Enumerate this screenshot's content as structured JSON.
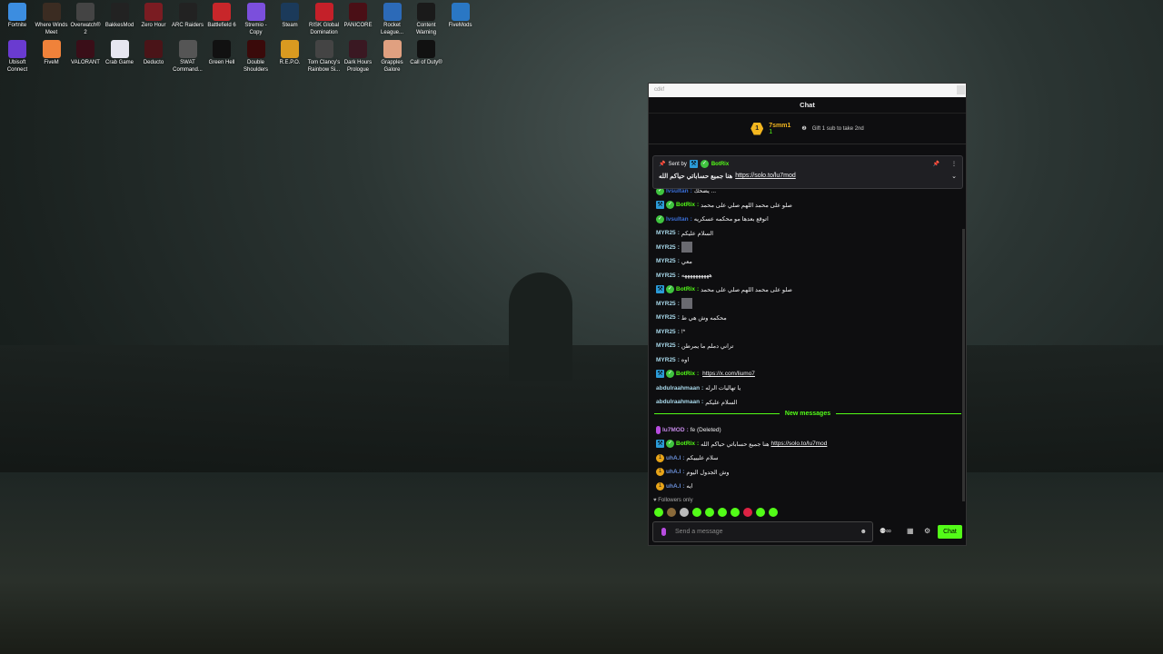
{
  "desktop": {
    "icons": [
      {
        "label": "Fortnite",
        "color": "#3c8de0"
      },
      {
        "label": "Where Winds Meet",
        "color": "#3b2c22"
      },
      {
        "label": "Overwatch® 2",
        "color": "#444"
      },
      {
        "label": "BakkesMod",
        "color": "#222"
      },
      {
        "label": "Zero Hour",
        "color": "#7a1c22"
      },
      {
        "label": "ARC Raiders",
        "color": "#222"
      },
      {
        "label": "Battlefield 6",
        "color": "#c8262a"
      },
      {
        "label": "Stremio - Copy",
        "color": "#7b4fdc"
      },
      {
        "label": "Steam",
        "color": "#1b3a5a"
      },
      {
        "label": "RISK Global Domination",
        "color": "#c42029"
      },
      {
        "label": "PANICORE",
        "color": "#4a0f16"
      },
      {
        "label": "Rocket League...",
        "color": "#2c6ab8"
      },
      {
        "label": "Content Warning",
        "color": "#1a1a1a"
      },
      {
        "label": "FiveMods",
        "color": "#2a77c4"
      },
      {
        "label": "Ubisoft Connect",
        "color": "#6a3bd0"
      },
      {
        "label": "FiveM",
        "color": "#f0823a"
      },
      {
        "label": "VALORANT",
        "color": "#3a0e18"
      },
      {
        "label": "Crab Game",
        "color": "#e6e6f0"
      },
      {
        "label": "Deducto",
        "color": "#4a1418"
      },
      {
        "label": "SWAT Command...",
        "color": "#555"
      },
      {
        "label": "Green Hell",
        "color": "#111"
      },
      {
        "label": "Double Shoulders",
        "color": "#3a0a0a"
      },
      {
        "label": "R.E.P.O.",
        "color": "#d99a20"
      },
      {
        "label": "Tom Clancy's Rainbow Si...",
        "color": "#444"
      },
      {
        "label": "Dark Hours Prologue",
        "color": "#3a1822"
      },
      {
        "label": "Grapples Galore",
        "color": "#e0a080"
      },
      {
        "label": "Call of Duty®",
        "color": "#111"
      }
    ]
  },
  "chat": {
    "address": "cdkf",
    "title": "Chat",
    "leader": {
      "rank": "1",
      "name": "7smm1",
      "count": "1",
      "gift_text": "Gift 1 sub to take 2nd"
    },
    "pinned": {
      "sent_by": "Sent by",
      "user": "BotRix",
      "text": "هنا جميع حساباتي حياكم الله",
      "link": "https://solo.to/lu7mod"
    },
    "messages": [
      {
        "user": "lvsultan",
        "text": "يضحك ...",
        "color": "#3a6fd8",
        "badges": [
          "verified"
        ]
      },
      {
        "user": "BotRix",
        "text": "صلو على محمد اللهم صلي على محمد",
        "color": "#53fc18",
        "badges": [
          "mod",
          "verified"
        ]
      },
      {
        "user": "lvsultan",
        "text": "اتوقع بعدها مو محكمه عسكريه",
        "color": "#3a6fd8",
        "badges": [
          "verified"
        ]
      },
      {
        "user": "MYR25",
        "text": "السلام عليكم",
        "color": "#a8d8ea",
        "badges": []
      },
      {
        "user": "MYR25",
        "text": "[emote]",
        "color": "#a8d8ea",
        "badges": []
      },
      {
        "user": "MYR25",
        "text": "معي",
        "color": "#a8d8ea",
        "badges": []
      },
      {
        "user": "MYR25",
        "text": "ههههههههههه",
        "color": "#a8d8ea",
        "badges": []
      },
      {
        "user": "BotRix",
        "text": "صلو على محمد اللهم صلي على محمد",
        "color": "#53fc18",
        "badges": [
          "mod",
          "verified"
        ]
      },
      {
        "user": "MYR25",
        "text": "[emote]",
        "color": "#a8d8ea",
        "badges": []
      },
      {
        "user": "MYR25",
        "text": "محكمه وش هي ط",
        "color": "#a8d8ea",
        "badges": []
      },
      {
        "user": "MYR25",
        "text": "!*",
        "color": "#a8d8ea",
        "badges": []
      },
      {
        "user": "MYR25",
        "text": "تراني دملم ما يمرطن",
        "color": "#a8d8ea",
        "badges": []
      },
      {
        "user": "MYR25",
        "text": "اوه",
        "color": "#a8d8ea",
        "badges": []
      },
      {
        "user": "BotRix",
        "text": "",
        "link": "https://x.com/liumo7",
        "color": "#53fc18",
        "badges": [
          "mod",
          "verified"
        ]
      },
      {
        "user": "abdulraahmaan",
        "text": "يا تهاليات الرله",
        "color": "#a8d8ea",
        "badges": []
      },
      {
        "user": "abdulraahmaan",
        "text": "السلام عليكم",
        "color": "#a8d8ea",
        "badges": []
      }
    ],
    "new_messages_label": "New messages",
    "new_messages": [
      {
        "user": "lu7MOD",
        "text": "fe (Deleted)",
        "color": "#c58ae8",
        "badges": [
          "mic"
        ]
      },
      {
        "user": "BotRix",
        "text": "هنا جميع حساباتي حياكم الله",
        "link": "https://solo.to/lu7mod",
        "color": "#53fc18",
        "badges": [
          "mod",
          "verified"
        ]
      },
      {
        "user": "uhA.I",
        "text": "سلام عليييكم",
        "color": "#6a8fd8",
        "badges": [
          "sub"
        ]
      },
      {
        "user": "uhA.I",
        "text": "وش الجدول اليوم",
        "color": "#6a8fd8",
        "badges": [
          "sub"
        ]
      },
      {
        "user": "uhA.I",
        "text": "ايه",
        "color": "#6a8fd8",
        "badges": [
          "sub"
        ]
      }
    ],
    "followers_only": "Followers only",
    "input_placeholder": "Send a message",
    "send_label": "Chat",
    "accent": "#53fc18"
  }
}
